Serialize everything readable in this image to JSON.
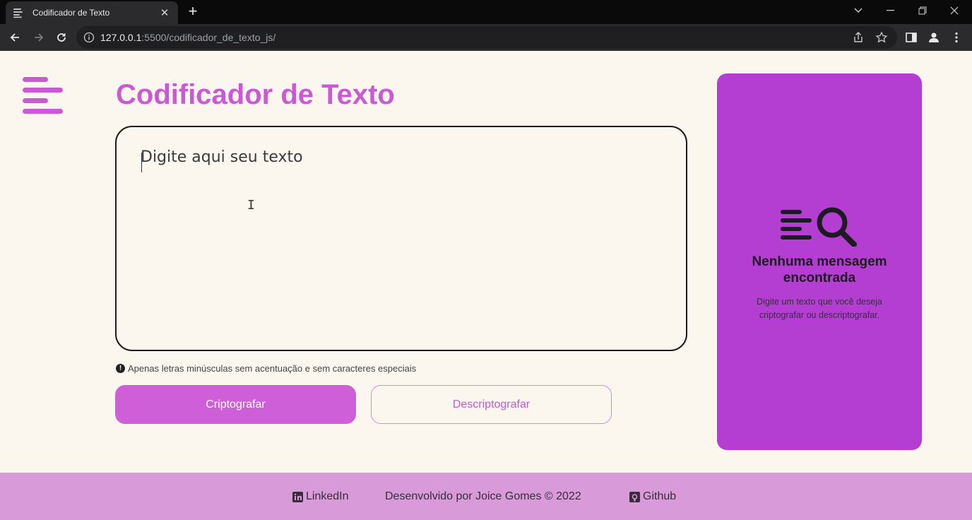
{
  "browser": {
    "tab_title": "Codificador de Texto",
    "new_tab_label": "+",
    "url_host": "127.0.0.1",
    "url_path": ":5500/codificador_de_texto_js/"
  },
  "app": {
    "title": "Codificador de Texto",
    "input_placeholder": "Digite aqui seu texto",
    "warning_text": "Apenas letras minúsculas sem acentuação e sem caracteres especiais",
    "warning_icon_glyph": "!",
    "encrypt_label": "Criptografar",
    "decrypt_label": "Descriptografar"
  },
  "side_panel": {
    "title": "Nenhuma mensagem encontrada",
    "text": "Digite um texto que você deseja criptografar ou descriptografar."
  },
  "footer": {
    "linkedin_label": "LinkedIn",
    "credit": "Desenvolvido por Joice Gomes © 2022",
    "github_label": "Github"
  },
  "colors": {
    "accent": "#c95ad3",
    "panel": "#b33ed1",
    "footer": "#d89ad9",
    "background": "#fbf7ef"
  },
  "icons": {
    "logo": "lines-logo-icon",
    "panel": "search-lines-icon",
    "linkedin": "linkedin-icon",
    "github": "github-icon"
  }
}
